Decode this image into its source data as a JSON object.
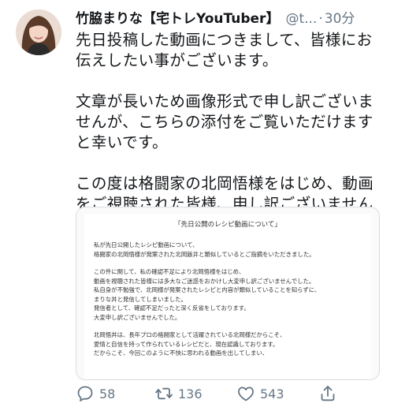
{
  "user": {
    "display_name": "竹脇まりな【宅トレYouTuber】",
    "handle": "@t...",
    "time": "30分"
  },
  "tweet": {
    "paragraphs": [
      "先日投稿した動画につきまして、皆様にお伝えしたい事がございます。",
      "文章が長いため画像形式で申し訳ございませんが、こちらの添付をご覧いただけますと幸いです。",
      "この度は格闘家の北岡悟様をはじめ、動画をご視聴された皆様、申し訳ございませんでした。"
    ]
  },
  "attachment": {
    "title": "「先日公開のレシピ動画について」",
    "lines": [
      "私が先日公開したレシピ動画について、",
      "格闘家の北岡悟様が発案された北岡飯井と類似しているとご指摘をいただきました。",
      "",
      "この件に関して、私の確認不足により北岡悟様をはじめ、",
      "動画を視聴された皆様には多大なご迷惑をおかけし大変申し訳ございませんでした。",
      "私自身が不勉強で、北岡様が発案されたレシピと内容が類似していることを知らずに、",
      "まりな丼と発信してしまいました。",
      "発信者として、確認不足だったと深く反省をしております。",
      "大変申し訳ございませんでした。",
      "",
      "北岡悟丼は、長年プロの格闘家として活躍されている北岡様だからこそ、",
      "愛情と自信を持って作られているレシピだと、現在認識しております。",
      "だからこそ、今回このように不快に思われる動画を出してしまい、"
    ]
  },
  "actions": {
    "reply_count": "58",
    "retweet_count": "136",
    "like_count": "543"
  },
  "colors": {
    "text": "#14171a",
    "secondary": "#657786",
    "border": "#d8dde1"
  },
  "icons": [
    "reply-icon",
    "retweet-icon",
    "like-icon",
    "share-icon"
  ]
}
